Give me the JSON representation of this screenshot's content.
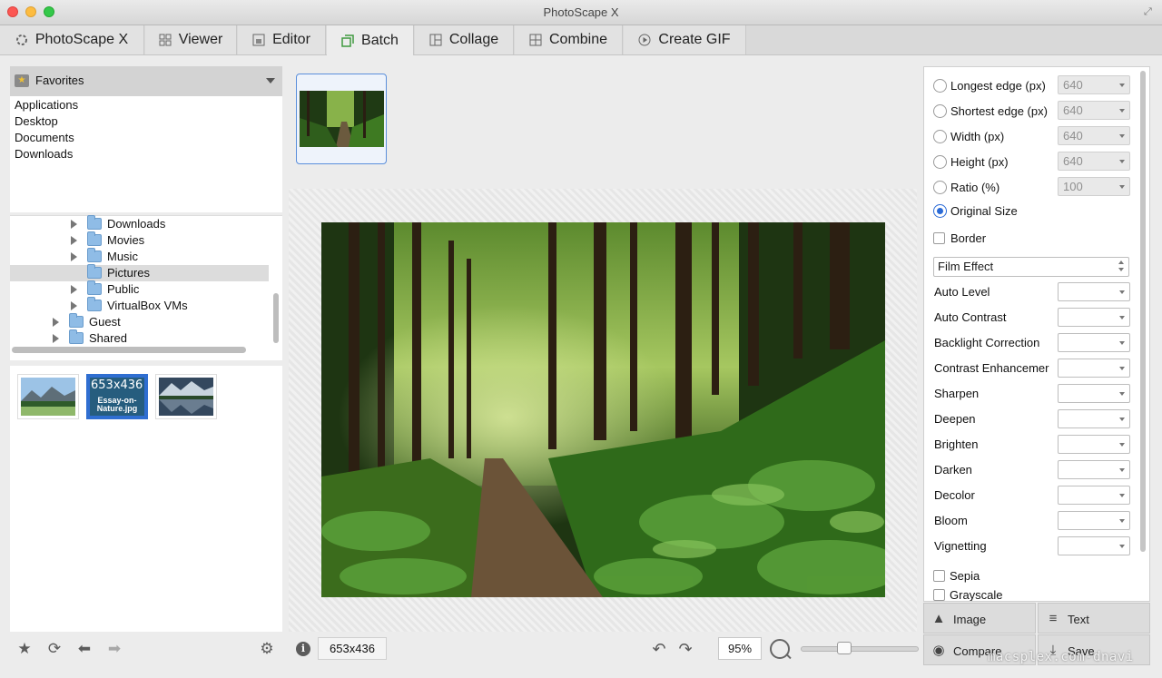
{
  "window": {
    "title": "PhotoScape X"
  },
  "tabs": [
    {
      "label": "PhotoScape X",
      "icon": "photoscape-icon"
    },
    {
      "label": "Viewer",
      "icon": "grid-icon"
    },
    {
      "label": "Editor",
      "icon": "editor-icon"
    },
    {
      "label": "Batch",
      "icon": "batch-icon",
      "active": true
    },
    {
      "label": "Collage",
      "icon": "collage-icon"
    },
    {
      "label": "Combine",
      "icon": "combine-icon"
    },
    {
      "label": "Create GIF",
      "icon": "play-icon"
    }
  ],
  "favorites": {
    "title": "Favorites",
    "items": [
      "Applications",
      "Desktop",
      "Documents",
      "Downloads"
    ]
  },
  "tree": {
    "items": [
      {
        "label": "Downloads",
        "level": 2,
        "expandable": true
      },
      {
        "label": "Movies",
        "level": 2,
        "expandable": true
      },
      {
        "label": "Music",
        "level": 2,
        "expandable": true
      },
      {
        "label": "Pictures",
        "level": 2,
        "expandable": false,
        "selected": true
      },
      {
        "label": "Public",
        "level": 2,
        "expandable": true
      },
      {
        "label": "VirtualBox VMs",
        "level": 2,
        "expandable": true
      },
      {
        "label": "Guest",
        "level": 1,
        "expandable": true
      },
      {
        "label": "Shared",
        "level": 1,
        "expandable": true
      }
    ]
  },
  "thumbnails": {
    "selected_size": "653x436",
    "selected_name": "Essay-on-Nature.jpg"
  },
  "center": {
    "image_size": "653x436",
    "zoom": "95%",
    "zoom_level": 0.35
  },
  "right_panel": {
    "resize_options": [
      {
        "label": "Longest edge (px)",
        "value": "640"
      },
      {
        "label": "Shortest edge (px)",
        "value": "640"
      },
      {
        "label": "Width (px)",
        "value": "640"
      },
      {
        "label": "Height (px)",
        "value": "640"
      },
      {
        "label": "Ratio (%)",
        "value": "100"
      }
    ],
    "original_size_label": "Original Size",
    "border_label": "Border",
    "film_effect_value": "Film Effect",
    "effects": [
      "Auto Level",
      "Auto Contrast",
      "Backlight Correction",
      "Contrast Enhancemer",
      "Sharpen",
      "Deepen",
      "Brighten",
      "Darken",
      "Decolor",
      "Bloom",
      "Vignetting"
    ],
    "checkboxes": [
      "Sepia",
      "Grayscale"
    ]
  },
  "bottom_buttons": {
    "image": "Image",
    "text": "Text",
    "compare": "Compare",
    "save": "Save"
  },
  "watermark": "macsplex.com-dnavi",
  "colors": {
    "selection_blue": "#2f6ed1",
    "radio_blue": "#2a6ad6",
    "forest_green": "#3f6b24"
  }
}
